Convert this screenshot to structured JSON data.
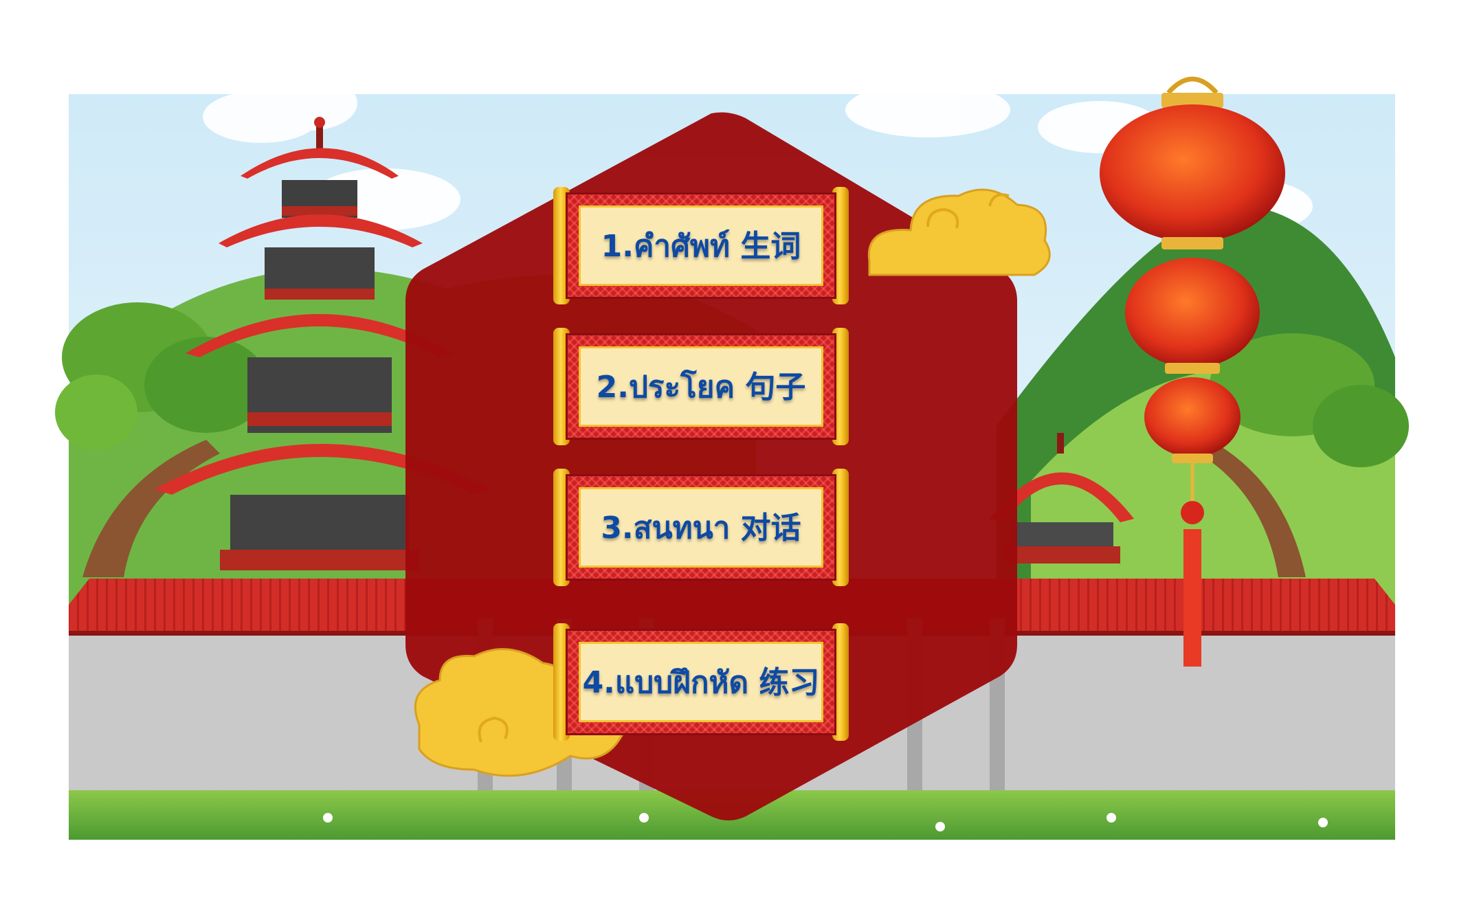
{
  "menu": {
    "items": [
      {
        "label": "1.คำศัพท์ 生词"
      },
      {
        "label": "2.ประโยค 句子"
      },
      {
        "label": "3.สนทนา 对话"
      },
      {
        "label": "4.แบบฝึกหัด 练习"
      }
    ]
  },
  "colors": {
    "sky": "#dff2fb",
    "hex_panel": "#9c0a0c",
    "banner_red": "#cf1d25",
    "banner_inner": "#fbe9b4",
    "label_blue": "#0e4aa3",
    "gold": "#f5c636",
    "grass": "#5aa83a",
    "wall": "#c9c9c9",
    "roof": "#d9302a"
  },
  "icons": [
    "pagoda-icon",
    "lantern-icon",
    "cloud-icon",
    "mountain-icon",
    "tree-icon",
    "gazebo-icon"
  ]
}
